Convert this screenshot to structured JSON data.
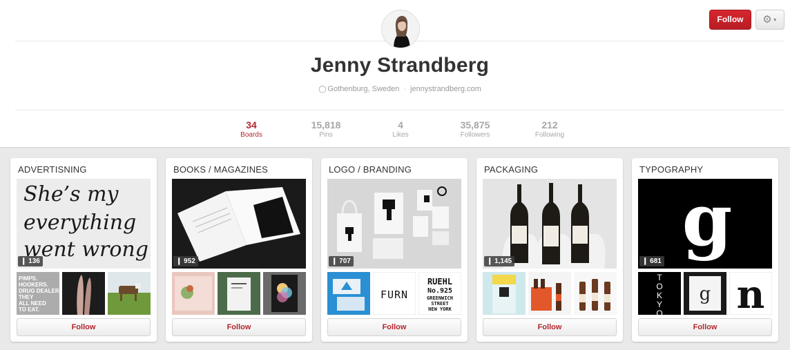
{
  "profile": {
    "name": "Jenny Strandberg",
    "location": "Gothenburg, Sweden",
    "website": "jennystrandberg.com",
    "follow_label": "Follow"
  },
  "stats": [
    {
      "value": "34",
      "label": "Boards",
      "active": true
    },
    {
      "value": "15,818",
      "label": "Pins",
      "active": false
    },
    {
      "value": "4",
      "label": "Likes",
      "active": false
    },
    {
      "value": "35,875",
      "label": "Followers",
      "active": false
    },
    {
      "value": "212",
      "label": "Following",
      "active": false
    }
  ],
  "boards": [
    {
      "title": "ADVERTISNING",
      "count": "136",
      "follow_label": "Follow",
      "cover_text": [
        "She’s my",
        "everything",
        "went wrong."
      ],
      "thumb_text": [
        "PIMPS.",
        "HOOKERS.",
        "DRUG DEALERS.",
        "THEY",
        "ALL NEED",
        "TO EAT."
      ]
    },
    {
      "title": "BOOKS / MAGAZINES",
      "count": "952",
      "follow_label": "Follow"
    },
    {
      "title": "LOGO / BRANDING",
      "count": "707",
      "follow_label": "Follow",
      "thumb_text": [
        "FURN",
        "RUEHL",
        "No.925",
        "GREENWICH",
        "STREET",
        "NEW YORK"
      ]
    },
    {
      "title": "PACKAGING",
      "count": "1,145",
      "follow_label": "Follow"
    },
    {
      "title": "TYPOGRAPHY",
      "count": "681",
      "follow_label": "Follow",
      "cover_text": [
        "g"
      ],
      "thumb_text": [
        "T",
        "O",
        "K",
        "Y",
        "O",
        "g",
        "n"
      ]
    }
  ],
  "colors": {
    "brand_red": "#b2262c",
    "stat_inactive": "#a7a7a7"
  },
  "icons": {
    "settings": "gear-icon",
    "location": "pin-icon",
    "count": "pin-icon"
  }
}
